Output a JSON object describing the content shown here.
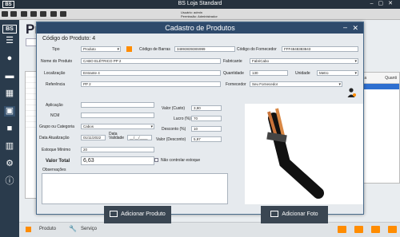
{
  "app": {
    "logo": "BS",
    "title": "BS Loja Standard"
  },
  "user": {
    "usuario_label": "Usuário:",
    "usuario": "admin",
    "permissao_label": "Permissão:",
    "permissao": "Administrador"
  },
  "main": {
    "title_partial": "Pr"
  },
  "bg_table": {
    "col1": "Pa",
    "col2": "Quanti"
  },
  "bottom": {
    "produto": "Produto",
    "servico": "Serviço"
  },
  "dialog": {
    "title": "Cadastro de Produtos",
    "product_code": "Código do Produto: 4",
    "fields": {
      "tipo_label": "Tipo",
      "tipo": "Produto",
      "codigo_barras_label": "Código de Barras",
      "codigo_barras": "3489383938S999",
      "codigo_fornecedor_label": "Código do Fornecedor",
      "codigo_fornecedor": "FFF4848383843",
      "nome_label": "Nome do Produto",
      "nome": "CABO ELÉTRICO PP 2",
      "fabricante_label": "Fabricante",
      "fabricante": "FabriCabo",
      "localizacao_label": "Localização",
      "localizacao": "Entrante 4",
      "quantidade_label": "Quantidade",
      "quantidade": "130",
      "unidade_label": "Unidade",
      "unidade": "Metro",
      "referencia_label": "Referência",
      "referencia": "PP 2",
      "fornecedor_label": "Fornecedor",
      "fornecedor": "Seu Fornecedor",
      "aplicacao_label": "Aplicação",
      "aplicacao": "",
      "ncm_label": "NCM",
      "ncm": "",
      "grupo_label": "Grupo ou Categoria",
      "grupo": "Cabos",
      "data_atualizacao_label": "Data Atualização",
      "data_atualizacao": "01/11/2022",
      "data_validade_label": "Data Validade",
      "data_validade": "__/__/____",
      "estoque_minimo_label": "Estoque Mínimo",
      "estoque_minimo": "20",
      "nao_controlar_label": "Não controlar estoque",
      "valor_custo_label": "Valor (Custo)",
      "valor_custo": "3,90",
      "lucro_label": "Lucro (%)",
      "lucro": "70",
      "desconto_label": "Desconto (%)",
      "desconto": "10",
      "valor_desconto_label": "Valor (Desconto)",
      "valor_desconto": "5,97",
      "valor_total_label": "Valor Total",
      "valor_total": "6,63",
      "observacoes_label": "Observações"
    },
    "buttons": {
      "add_product": "Adicionar Produto",
      "add_photo": "Adicionar Foto"
    }
  },
  "colors": {
    "accent": "#ff8c00",
    "titlebar": "#2e4a6b",
    "sidebar": "#2a3b4c"
  }
}
